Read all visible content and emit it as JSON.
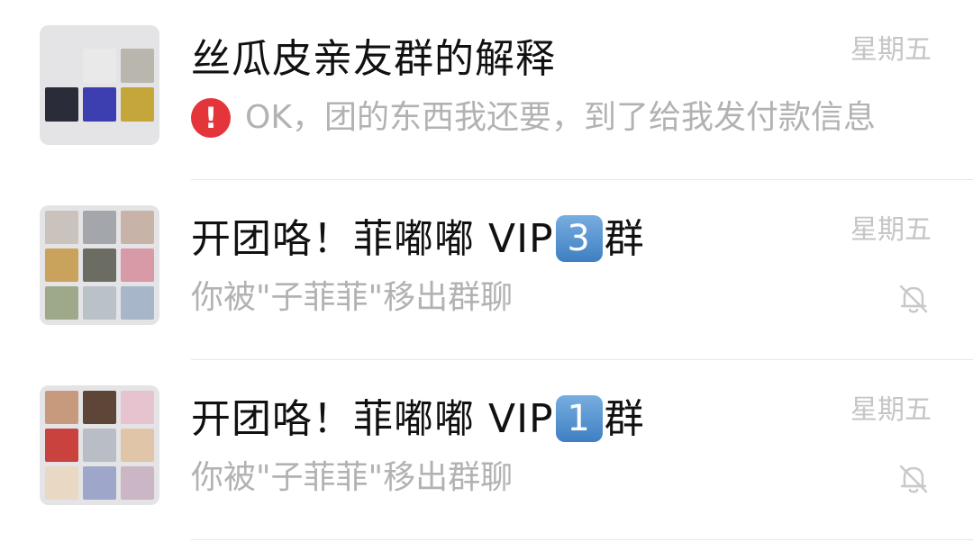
{
  "chats": [
    {
      "title": "丝瓜皮亲友群的解释",
      "time": "星期五",
      "alert_glyph": "!",
      "preview": "OK，团的东西我还要，到了给我发付款信息",
      "muted": false,
      "unread_alert": true,
      "avatar_colors": [
        "#e9e9ea",
        "#b8b6ad",
        "#9d8466",
        "#2b2c3a",
        "#3d3fb0",
        "#c4a63a"
      ]
    },
    {
      "title_prefix": "开团咯！菲嘟嘟 VIP",
      "title_badge": "3",
      "title_suffix": "群",
      "time": "星期五",
      "preview": "你被\"子菲菲\"移出群聊",
      "muted": true,
      "mute_icon": "bell-muted-icon",
      "avatar_colors": [
        "#c9c2bd",
        "#a3a7ac",
        "#c8b3a9",
        "#c9a35b",
        "#6b6d63",
        "#d79aa6",
        "#9ea98a",
        "#b9c2c6",
        "#a7b7c9",
        "#b08950",
        "#2d2b2a",
        "#d9d4d0"
      ]
    },
    {
      "title_prefix": "开团咯！菲嘟嘟 VIP",
      "title_badge": "1",
      "title_suffix": "群",
      "time": "星期五",
      "preview": "你被\"子菲菲\"移出群聊",
      "muted": true,
      "mute_icon": "bell-muted-icon",
      "avatar_colors": [
        "#c89a7d",
        "#5d4538",
        "#e7c3cf",
        "#c9423e",
        "#b9bec6",
        "#e1c5a8",
        "#e8d8c4",
        "#9ea6c9",
        "#cbb6c6"
      ]
    }
  ]
}
